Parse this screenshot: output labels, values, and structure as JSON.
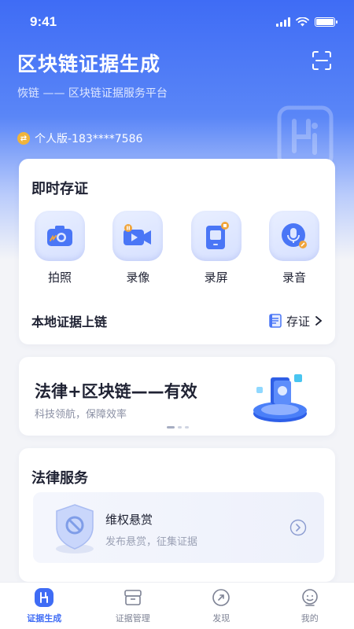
{
  "status_bar": {
    "time": "9:41"
  },
  "header": {
    "title": "区块链证据生成",
    "subtitle": "恢链 —— 区块链证据服务平台",
    "edition_label": "个人版-183****7586",
    "scan_icon": "scan-icon"
  },
  "instant_evidence": {
    "title": "即时存证",
    "tools": [
      {
        "label": "拍照",
        "icon": "camera-icon"
      },
      {
        "label": "录像",
        "icon": "video-icon"
      },
      {
        "label": "录屏",
        "icon": "screen-record-icon"
      },
      {
        "label": "录音",
        "icon": "microphone-icon"
      }
    ],
    "local_upload": {
      "title": "本地证据上链",
      "action_label": "存证"
    }
  },
  "banner": {
    "title": "法律+区块链——有效",
    "subtitle": "科技领航，保障效率",
    "page_count": 3,
    "active_page": 1
  },
  "legal_services": {
    "title": "法律服务",
    "items": [
      {
        "name": "维权悬赏",
        "description": "发布悬赏，征集证据",
        "icon": "shield-icon"
      }
    ]
  },
  "tabbar": {
    "active": 0,
    "tabs": [
      {
        "label": "证据生成",
        "icon": "evidence-icon"
      },
      {
        "label": "证据管理",
        "icon": "archive-icon"
      },
      {
        "label": "发现",
        "icon": "compass-icon"
      },
      {
        "label": "我的",
        "icon": "profile-icon"
      }
    ]
  },
  "colors": {
    "primary": "#3f6cf5",
    "accent_orange": "#f0a53c",
    "background": "#f3f4f8"
  }
}
